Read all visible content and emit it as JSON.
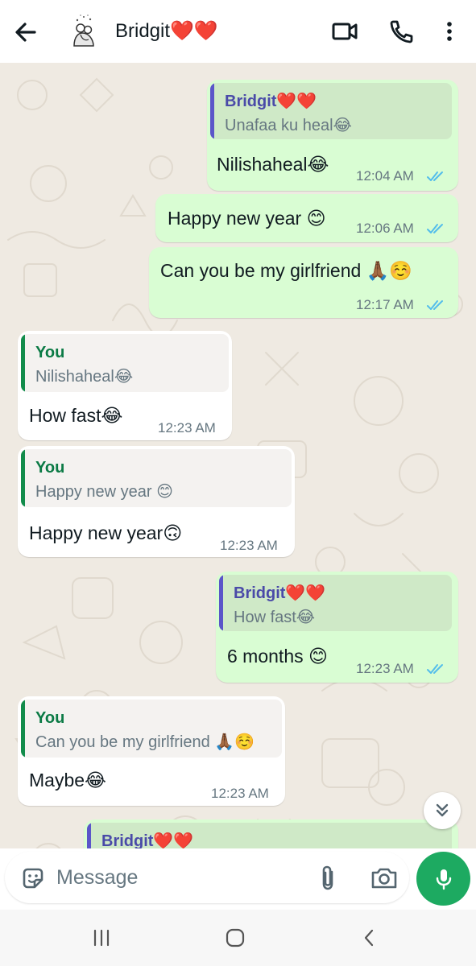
{
  "header": {
    "contact_name": "Bridgit❤️❤️"
  },
  "messages": [
    {
      "dir": "out",
      "quote_author": "Bridgit❤️❤️",
      "quote_text": "Unafaa ku heal😂",
      "text": "Nilishaheal😂",
      "time": "12:04 AM",
      "read": true
    },
    {
      "dir": "out",
      "text": "Happy new year 😊",
      "time": "12:06 AM",
      "read": true
    },
    {
      "dir": "out",
      "text": "Can you be my girlfriend 🙏🏾☺️",
      "time": "12:17 AM",
      "read": true
    },
    {
      "dir": "in",
      "quote_author": "You",
      "quote_text": "Nilishaheal😂",
      "text": "How fast😂",
      "time": "12:23 AM"
    },
    {
      "dir": "in",
      "quote_author": "You",
      "quote_text": "Happy new year 😊",
      "text": "Happy new year🙃",
      "time": "12:23 AM"
    },
    {
      "dir": "out",
      "quote_author": "Bridgit❤️❤️",
      "quote_text": "How fast😂",
      "text": "6 months 😊",
      "time": "12:23 AM",
      "read": true
    },
    {
      "dir": "in",
      "quote_author": "You",
      "quote_text": "Can you be my girlfriend 🙏🏾☺️",
      "text": "Maybe😂",
      "time": "12:23 AM"
    },
    {
      "dir": "out",
      "quote_author": "Bridgit❤️❤️"
    }
  ],
  "composer": {
    "placeholder": "Message"
  },
  "icons": {
    "back": "arrow-left-icon",
    "video": "video-camera-icon",
    "call": "phone-icon",
    "menu": "more-vertical-icon",
    "sticker": "sticker-icon",
    "attach": "paperclip-icon",
    "camera": "camera-icon",
    "mic": "microphone-icon",
    "scroll": "double-chevron-down-icon"
  },
  "colors": {
    "outgoing_bubble": "#d9fdd3",
    "incoming_bubble": "#ffffff",
    "chat_background": "#efeae2",
    "accent_green": "#1daa61",
    "read_ticks": "#53bdeb",
    "quote_bar_self": "#5b55c9",
    "quote_bar_other": "#128c4b"
  }
}
